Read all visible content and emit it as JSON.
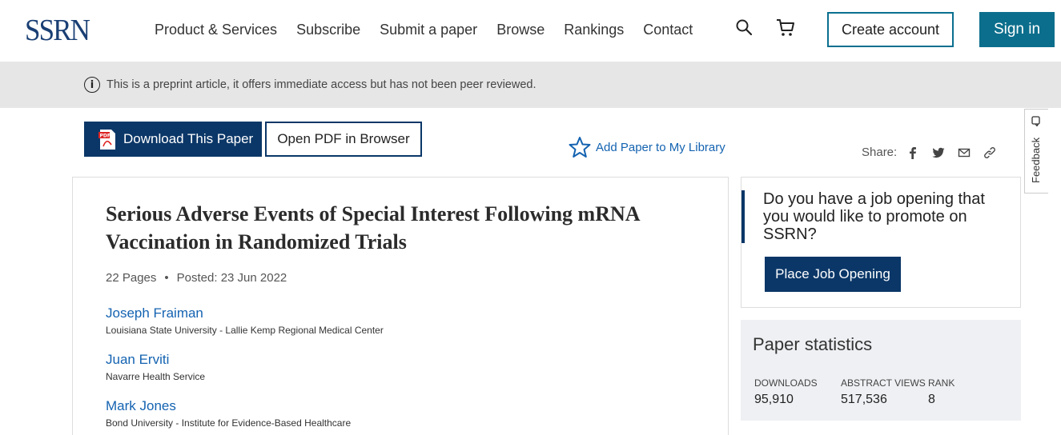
{
  "header": {
    "logo": "SSRN",
    "nav": [
      "Product & Services",
      "Subscribe",
      "Submit a paper",
      "Browse",
      "Rankings",
      "Contact"
    ],
    "icons": [
      "search-icon",
      "cart-icon"
    ],
    "create_account": "Create account",
    "sign_in": "Sign in"
  },
  "notice": {
    "icon": "info-icon",
    "text": "This is a preprint article, it offers immediate access but has not been peer reviewed."
  },
  "actions": {
    "download": "Download This Paper",
    "open_pdf": "Open PDF in Browser",
    "add_library": "Add Paper to My Library",
    "share_label": "Share:",
    "share_icons": [
      "facebook-icon",
      "twitter-icon",
      "email-icon",
      "link-icon"
    ]
  },
  "feedback": {
    "label": "Feedback"
  },
  "paper": {
    "title": "Serious Adverse Events of Special Interest Following mRNA Vaccination in Randomized Trials",
    "pages": "22 Pages",
    "posted": "Posted: 23 Jun 2022",
    "authors": [
      {
        "name": "Joseph Fraiman",
        "affiliation": "Louisiana State University - Lallie Kemp Regional Medical Center"
      },
      {
        "name": "Juan Erviti",
        "affiliation": "Navarre Health Service"
      },
      {
        "name": "Mark Jones",
        "affiliation": "Bond University - Institute for Evidence-Based Healthcare"
      }
    ]
  },
  "job": {
    "question": "Do you have a job opening that you would like to promote on SSRN?",
    "button": "Place Job Opening"
  },
  "stats": {
    "title": "Paper statistics",
    "downloads_label": "DOWNLOADS",
    "downloads": "95,910",
    "views_label": "ABSTRACT VIEWS",
    "views": "517,536",
    "rank_label": "RANK",
    "rank": "8"
  },
  "colors": {
    "brand_navy": "#0b3768",
    "teal": "#0b6e8c",
    "link_blue": "#1463b1",
    "notice_bg": "#e6e6e6"
  }
}
